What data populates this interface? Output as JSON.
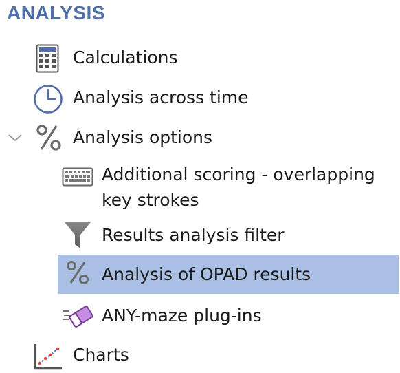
{
  "section": {
    "title": "ANALYSIS"
  },
  "items": [
    {
      "label": "Calculations",
      "icon": "calculator-icon"
    },
    {
      "label": "Analysis across time",
      "icon": "clock-icon"
    },
    {
      "label": "Analysis options",
      "icon": "percent-icon",
      "expanded": true,
      "children": [
        {
          "label_line1": "Additional scoring - overlapping",
          "label_line2": "key strokes",
          "icon": "keyboard-icon"
        },
        {
          "label": "Results analysis filter",
          "icon": "filter-funnel-icon"
        },
        {
          "label": "Analysis of OPAD results",
          "icon": "percent-icon",
          "selected": true
        },
        {
          "label": "ANY-maze plug-ins",
          "icon": "plugin-eraser-icon"
        }
      ]
    },
    {
      "label": "Charts",
      "icon": "chart-icon"
    }
  ],
  "colors": {
    "header": "#4f6fa8",
    "selection": "#a9c0e4"
  }
}
